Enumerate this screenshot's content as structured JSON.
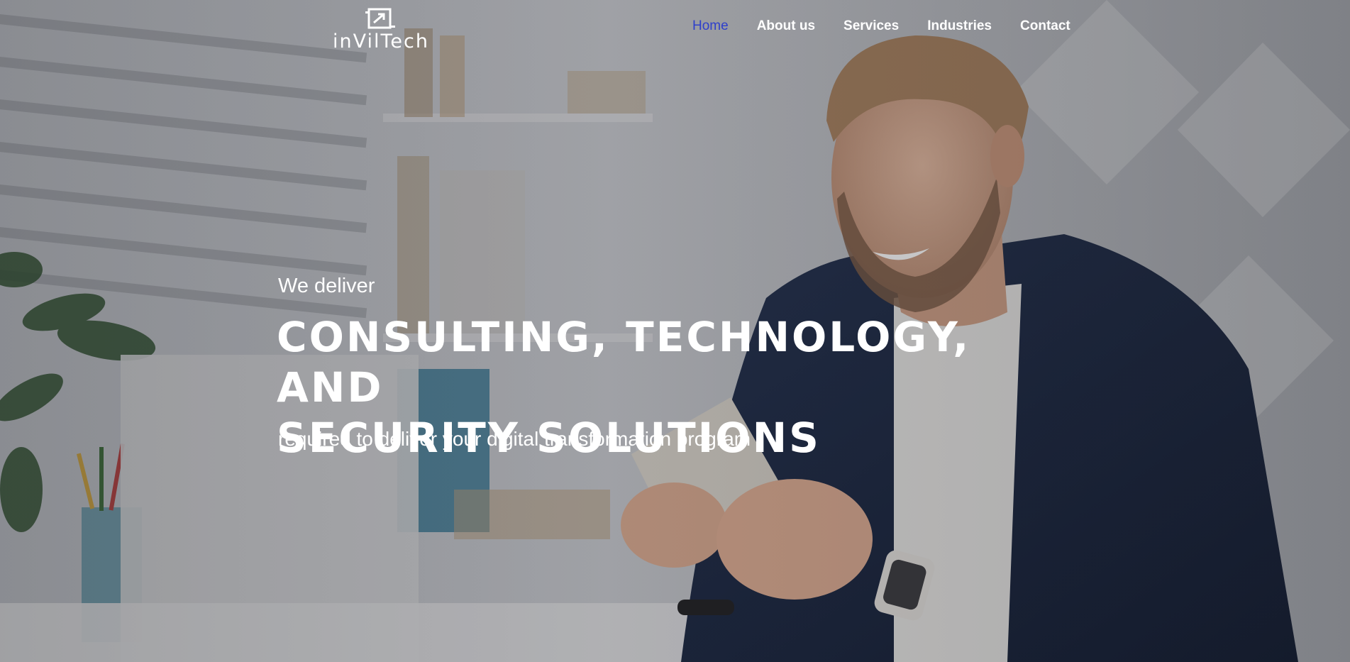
{
  "brand": {
    "logo_text": "inVilTech",
    "icon": "logo-mark-icon"
  },
  "nav": {
    "items": [
      {
        "label": "Home",
        "active": true
      },
      {
        "label": "About us",
        "active": false
      },
      {
        "label": "Services",
        "active": false
      },
      {
        "label": "Industries",
        "active": false
      },
      {
        "label": "Contact",
        "active": false
      }
    ],
    "active_color": "#2e3fcb",
    "text_color": "#ffffff"
  },
  "hero": {
    "kicker": "We deliver",
    "headline_line1": "CONSULTING, TECHNOLOGY, AND",
    "headline_line2": "SECURITY SOLUTIONS",
    "subline": "required to deliver your digital transformation program",
    "image": "smiling-man-with-tablet-in-office-photo"
  }
}
